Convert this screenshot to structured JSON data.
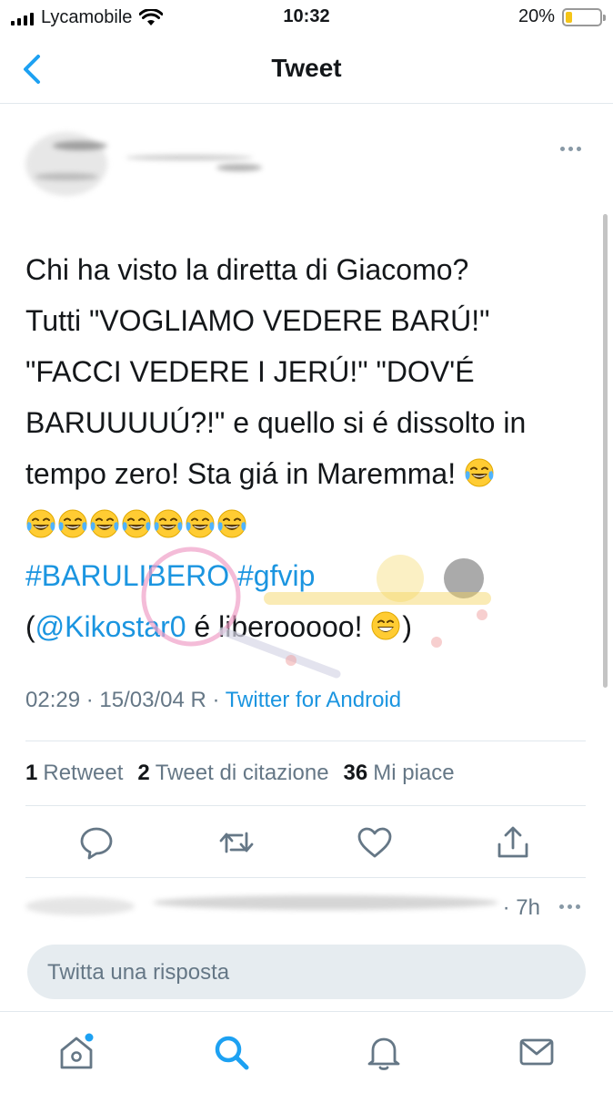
{
  "status_bar": {
    "carrier": "Lycamobile",
    "time": "10:32",
    "battery": "20%",
    "battery_level": 0.2
  },
  "nav": {
    "title": "Tweet",
    "back_icon": "chevron-left-icon"
  },
  "tweet": {
    "lines": [
      "Chi ha visto la diretta di Giacomo?",
      "Tutti \"VOGLIAMO VEDERE BARÚ!\"",
      "\"FACCI VEDERE I JERÚ!\" \"DOV'É",
      "BARUUUUÚ?!\" e quello si é dissolto in",
      "tempo zero! Sta giá in Maremma!"
    ],
    "hashtag_1": "#BARULIBERO",
    "hashtag_2": "#gfvip",
    "mention_open": "(",
    "mention": "@Kikostar0",
    "mention_rest": " é liberooooo!",
    "mention_close": ")",
    "emoji_laugh_count": 8,
    "emoji_grin_count": 1
  },
  "meta": {
    "time": "02:29 · 15/03/04 R · ",
    "source": "Twitter for Android"
  },
  "stats": {
    "retweets_count": "1",
    "retweets_label": "Retweet",
    "quotes_count": "2",
    "quotes_label": "Tweet di citazione",
    "likes_count": "36",
    "likes_label": "Mi piace"
  },
  "actions": {
    "reply_icon": "reply-icon",
    "retweet_icon": "retweet-icon",
    "like_icon": "heart-icon",
    "share_icon": "share-icon"
  },
  "reply_preview": {
    "time": "· 7h"
  },
  "compose": {
    "placeholder": "Twitta una risposta"
  },
  "tabs": {
    "home_icon": "home-icon",
    "search_icon": "search-icon",
    "notifications_icon": "bell-icon",
    "messages_icon": "mail-icon"
  },
  "colors": {
    "accent": "#1da1f2",
    "link": "#1b95e0",
    "muted": "#657786",
    "battery": "#f5c518"
  }
}
